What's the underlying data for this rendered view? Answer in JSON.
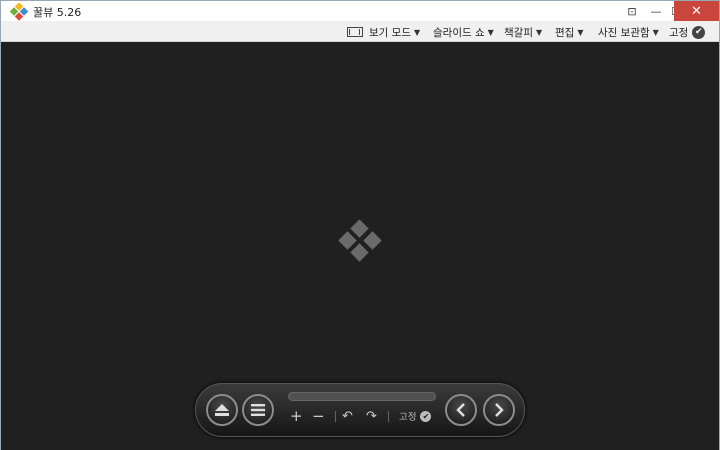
{
  "window": {
    "title": "꿀뷰 5.26"
  },
  "titlebar_buttons": {
    "close_glyph": "✕",
    "max_glyph": "☐",
    "min_glyph": "—",
    "pin_glyph": "⊡"
  },
  "menu": {
    "items": [
      {
        "label": "보기 모드",
        "icon": "view-mode-icon"
      },
      {
        "label": "슬라이드 쇼"
      },
      {
        "label": "책갈피"
      },
      {
        "label": "편집"
      },
      {
        "label": "사진 보관함"
      }
    ],
    "fix_label": "고정",
    "arrow": "▼",
    "check": "✔"
  },
  "controls": {
    "eject_icon": "eject-icon",
    "list_icon": "list-icon",
    "zoom_in": "+",
    "zoom_out": "−",
    "rotate_left": "↶",
    "rotate_right": "↷",
    "fix_label": "고정",
    "check": "✔",
    "prev": "‹",
    "next": "›"
  },
  "colors": {
    "viewer_bg": "#202020",
    "close_button": "#c9463d",
    "menubar_bg": "#f0f0f0"
  }
}
